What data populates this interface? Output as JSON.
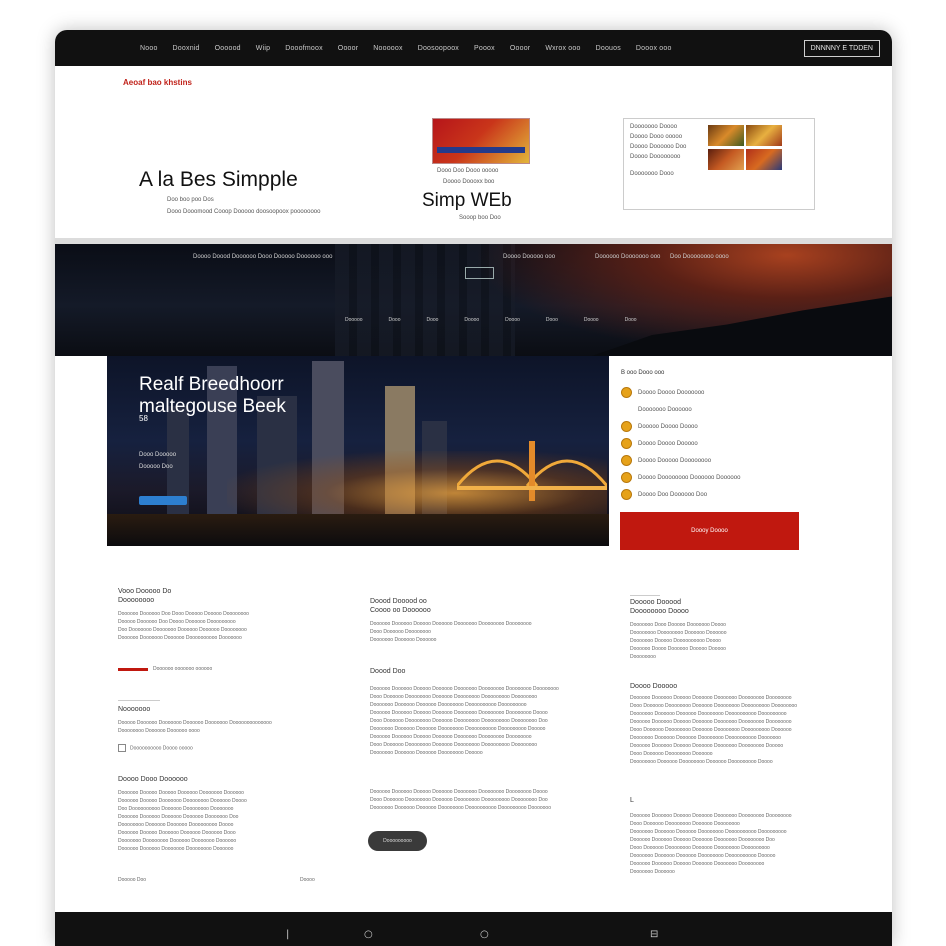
{
  "nav": {
    "items": [
      "Nooo",
      "Dooxnid",
      "Oooood",
      "Wiip",
      "Dooofmoox",
      "Oooor",
      "Nooooox",
      "Doosoopoox",
      "Pooox",
      "Oooor",
      "Wxrox ooo",
      "Doouos",
      "Dooox ooo",
      "Dooooos"
    ],
    "cta": "DNNNNY E TDDEN"
  },
  "hero": {
    "brand_tag": "Aeoaf bao khstins",
    "title": "A la Bes Simpple",
    "sub1": "Doo boo poo Dos",
    "sub2": "Dooo Dooomood Cooop Dooooo doosoopoox poooooooo"
  },
  "ad": {
    "line1": "Dooo Doo Dooo ooooo",
    "line2": "Doooo Doooxx boo",
    "title": "Simp WEb",
    "line3": "Sooop boo Doo"
  },
  "gallery": {
    "lines": [
      "Dooooooo Doooo",
      "Doooo Dooo ooooo",
      "Doooo Doooooo Doo",
      "Doooo Doooooooo",
      "Dooooooo Dooo"
    ]
  },
  "band": {
    "line1": "Doooo Doood Doooooo Dooo  Dooooo Doooooo ooo",
    "line2": "Doooo Dooooo ooo",
    "line3": "Doooooo Dooooooo ooo",
    "line4": "Doo Doooooooo oooo",
    "nav": [
      "Dooooo",
      "Dooo",
      "Dooo",
      "Doooo",
      "Doooo",
      "Dooo",
      "Doooo",
      "Dooo"
    ]
  },
  "feature": {
    "title": "Realf Breedhoorr",
    "title2": "maltegouse Beek",
    "num": "58",
    "line1": "Dooo Dooooo",
    "line2": "Dooooo Doo"
  },
  "flist": {
    "head": "B ooo Dooo ooo",
    "items": [
      "Doooo Doooo Dooooooo",
      "Dooooooo Doooooo",
      "Dooooo Doooo Doooo",
      "Doooo Doooo Dooooo",
      "Doooo Dooooo Doooooooo",
      "Doooo Doooooooo Doooooo Doooooo",
      "Doooo Doo Doooooo Doo"
    ]
  },
  "cta_red": "Doooy Doooo",
  "col1": {
    "head1": "Vooo Dooooo Do",
    "head2": "Doooooooo",
    "para1": [
      "Doooooo Doooooo Doo Dooo Dooooo Dooooo Doooooooo",
      "Dooooo Doooooo Doo Doooo Doooooo Dooooooooo",
      "Doo Dooooooo Dooooooo Doooooo Doooooo Doooooooo",
      "Doooooo Dooooooo Doooooo Doooooooooo Dooooooo"
    ],
    "link": "Doooooo ooooooo oooooo",
    "head3": "Nooooooo",
    "para2": [
      "Dooooo Doooooo Dooooooo Doooooo Dooooooo Doooooooooooooo",
      "Doooooooo Doooooo Doooooo oooo"
    ],
    "checkbox": "Doooooooooo Doooo ooooo",
    "head4": "Doooo Dooo Doooooo",
    "para3": [
      "Doooooo Dooooo Dooooo Doooooo Dooooooo Doooooo",
      "Doooooo Dooooo Dooooooo Doooooooo Doooooo Doooo",
      "Doo Doooooooooo Doooooo Doooooooo Dooooooo",
      "Doooooo Doooooo Doooooo Doooooo Dooooooo Doo",
      "Doooooooo Doooooo Doooooo Dooooooooo Doooo",
      "Doooooo Dooooo Doooooo Doooooo Doooooo Dooo",
      "Dooooooo Doooooooo Doooooo Dooooooo Doooooo",
      "Doooooo Doooooo Dooooooo Doooooooo Doooooo"
    ],
    "foot_left": "Dooooo Doo",
    "foot_right": "Doooo"
  },
  "col2": {
    "head1": "Doood Dooood oo",
    "head2": "Coooo oo Doooooo",
    "para1": [
      "Doooooo Doooooo Dooooo Doooooo Dooooooo Doooooooo Doooooooo",
      "Dooo Doooooo Doooooooo",
      "Dooooooo Doooooo Doooooo"
    ],
    "head3": "Doood Doo",
    "para2": [
      "Doooooo Doooooo Dooooo Doooooo Dooooooo Doooooooo Doooooooo Doooooooo",
      "Dooo Doooooo Doooooooo Doooooo Doooooooo Dooooooooo Doooooooo",
      "Dooooooo Doooooo Doooooo Doooooooo Doooooooooo Dooooooooo",
      "Doooooo Doooooo Dooooo Doooooo Dooooooo Doooooooo Doooooooo Doooo",
      "Dooo Doooooo Doooooooo Doooooo Doooooooo Dooooooooo Doooooooo Doo",
      "Dooooooo Doooooo Doooooo Doooooooo Doooooooooo Dooooooooo Dooooo",
      "Doooooo Doooooo Dooooo Doooooo Dooooooo Doooooooo Doooooooo",
      "Dooo Doooooo Doooooooo Doooooo Doooooooo Dooooooooo Doooooooo",
      "Dooooooo Doooooo Doooooo Doooooooo Dooooo"
    ],
    "para3": [
      "Doooooo Doooooo Dooooo Doooooo Dooooooo Doooooooo Doooooooo Doooo",
      "Dooo Doooooo Doooooooo Doooooo Doooooooo Dooooooooo Doooooooo Doo",
      "Dooooooo Doooooo Doooooo Doooooooo Doooooooooo Dooooooooo Dooooooo"
    ],
    "button": "Dooooooooo"
  },
  "col3": {
    "head1": "Dooooo Dooood",
    "head2": "Doooooooo Doooo",
    "para1": [
      "Dooooooo Dooo Dooooo Dooooooo Doooo",
      "Doooooooo Doooooooo Doooooo Doooooo",
      "Dooooooo Dooooo Doooooooooo Doooo",
      "Doooooo Doooo Doooooo Dooooo Dooooo",
      "Doooooooo"
    ],
    "head3": "Doooo Dooooo",
    "para2": [
      "Doooooo Doooooo Dooooo Doooooo Dooooooo Doooooooo Doooooooo",
      "Dooo Doooooo Doooooooo Doooooo Doooooooo Dooooooooo Doooooooo",
      "Dooooooo Doooooo Doooooo Doooooooo Doooooooooo Dooooooooo",
      "Doooooo Doooooo Dooooo Doooooo Dooooooo Doooooooo Doooooooo",
      "Dooo Doooooo Doooooooo Doooooo Doooooooo Dooooooooo Doooooo",
      "Dooooooo Doooooo Doooooo Doooooooo Doooooooooo Dooooooo",
      "Doooooo Doooooo Dooooo Doooooo Dooooooo Doooooooo Dooooo",
      "Dooo Doooooo Doooooooo Doooooo",
      "Doooooooo Doooooo Doooooooo Doooooo Dooooooooo Doooo"
    ],
    "mark": "L",
    "para3": [
      "Doooooo Doooooo Dooooo Doooooo Dooooooo Doooooooo Doooooooo",
      "Dooo Doooooo Doooooooo Doooooo Doooooooo",
      "Dooooooo Doooooo Doooooo Doooooooo Doooooooooo Dooooooooo",
      "Doooooo Doooooo Dooooo Doooooo Dooooooo Doooooooo Doo",
      "Dooo Doooooo Doooooooo Doooooo Doooooooo Dooooooooo",
      "Dooooooo Doooooo Doooooo Doooooooo Doooooooooo Dooooo",
      "Doooooo Doooooo Dooooo Doooooo Dooooooo Doooooooo",
      "Dooooooo Doooooo"
    ]
  },
  "bottom_icons": [
    "|",
    "○",
    "○",
    "⊟"
  ],
  "colors": {
    "accent_red": "#c0180f",
    "accent_orange": "#e6a21a",
    "accent_blue": "#2d7fd0",
    "bezel": "#111111"
  }
}
